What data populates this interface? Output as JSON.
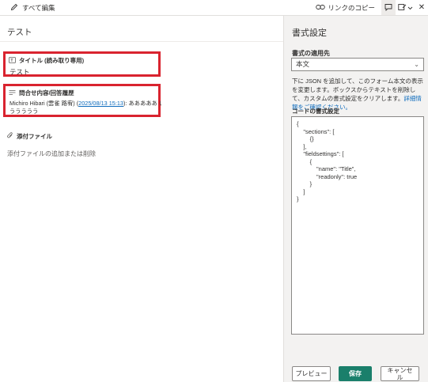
{
  "topbar": {
    "edit_all_label": "すべて編集",
    "copy_link_label": "リンクのコピー"
  },
  "form": {
    "title": "テスト",
    "fields": [
      {
        "label": "タイトル (読み取り専用)",
        "value": "テスト"
      },
      {
        "label": "問合せ内容/回答履歴",
        "author": "Michiro Hibari (雲雀 路宥)",
        "timestamp": "2025/08/13 15:13",
        "text_after_link": ": あああああ いいいいい",
        "text_line2": "ううううう"
      }
    ],
    "attachments": {
      "label": "添付ファイル",
      "hint": "添付ファイルの追加または削除"
    }
  },
  "pane": {
    "title": "書式設定",
    "apply_label": "書式の適用先",
    "apply_value": "本文",
    "description": "下に JSON を追加して、このフォーム本文の表示を変更します。ボックスからテキストを削除して、カスタムの書式設定をクリアします。",
    "learn_more": "詳細情報をご確認ください。",
    "code_label": "コードの書式設定",
    "code": "{\n    \"sections\": [\n        {}\n    ],\n    \"fieldsettings\": [\n        {\n            \"name\": \"Title\",\n            \"readonly\": true\n        }\n    ]\n}",
    "buttons": {
      "preview": "プレビュー",
      "save": "保存",
      "cancel": "キャンセル"
    }
  },
  "colors": {
    "accent": "#1a7f6b",
    "highlight_border": "#d9232f",
    "link": "#0f6cbd"
  }
}
